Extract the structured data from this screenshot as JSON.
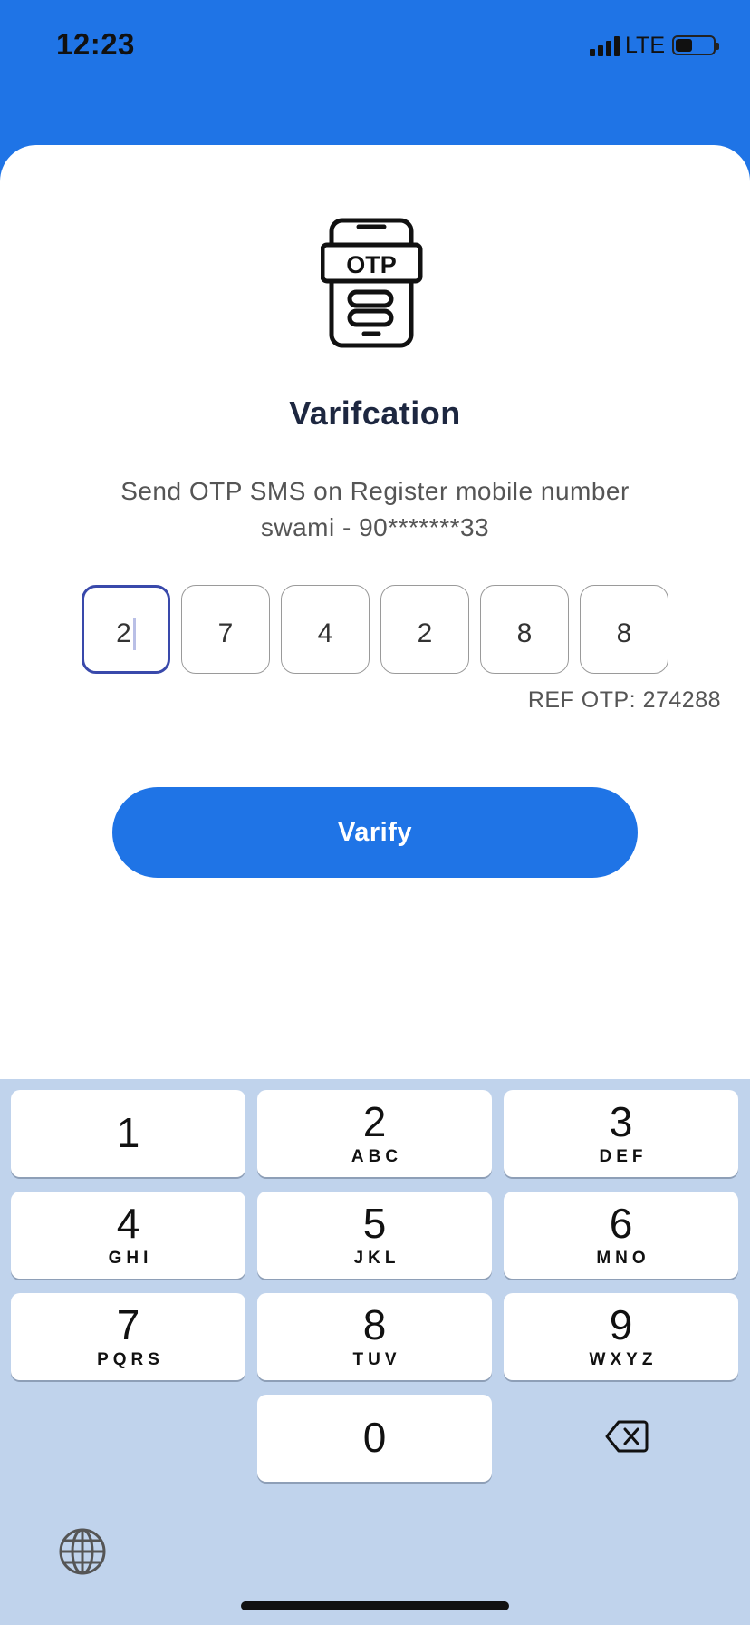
{
  "status_bar": {
    "time": "12:23",
    "network": "LTE",
    "battery_level": 0.4
  },
  "screen": {
    "illustration_label": "OTP",
    "title": "Varifcation",
    "subtitle_line1": "Send OTP SMS on Register mobile number",
    "subtitle_line2": "swami - 90*******33",
    "otp_digits": [
      "2",
      "7",
      "4",
      "2",
      "8",
      "8"
    ],
    "ref_otp": "REF OTP: 274288",
    "verify_label": "Varify"
  },
  "keypad": {
    "keys": [
      {
        "digit": "1",
        "letters": ""
      },
      {
        "digit": "2",
        "letters": "ABC"
      },
      {
        "digit": "3",
        "letters": "DEF"
      },
      {
        "digit": "4",
        "letters": "GHI"
      },
      {
        "digit": "5",
        "letters": "JKL"
      },
      {
        "digit": "6",
        "letters": "MNO"
      },
      {
        "digit": "7",
        "letters": "PQRS"
      },
      {
        "digit": "8",
        "letters": "TUV"
      },
      {
        "digit": "9",
        "letters": "WXYZ"
      },
      {
        "digit": "0",
        "letters": ""
      }
    ],
    "icons": [
      "backspace-icon",
      "globe-icon"
    ]
  },
  "colors": {
    "header_blue": "#1f74e6",
    "active_border": "#3949ab",
    "keypad_bg": "#c0d3ec"
  }
}
